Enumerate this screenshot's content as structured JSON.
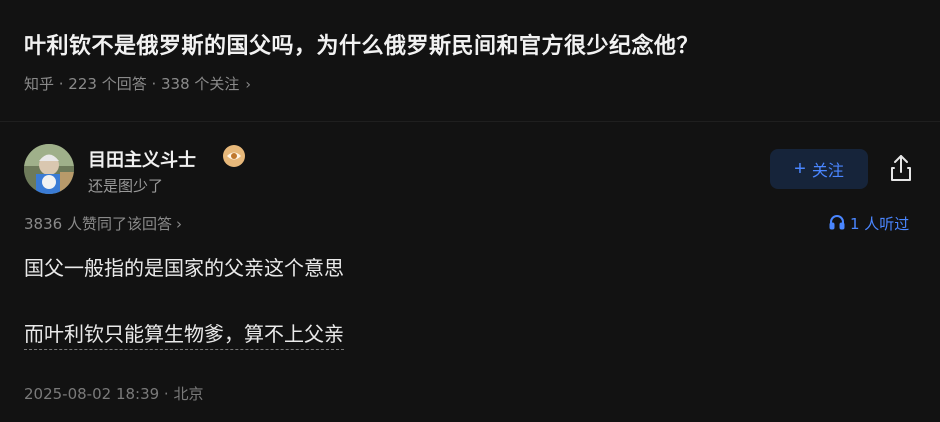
{
  "question": {
    "title": "叶利钦不是俄罗斯的国父吗，为什么俄罗斯民间和官方很少纪念他？",
    "meta": "知乎 · 223 个回答 · 338 个关注"
  },
  "author": {
    "name": "目田主义斗士",
    "bio": "还是图少了",
    "badge_icon": "eye-badge-icon"
  },
  "actions": {
    "follow_label": "关注",
    "share_icon": "share-icon"
  },
  "answer": {
    "likes_text": "3836 人赞同了该回答",
    "listen_text": "1 人听过",
    "paragraphs": [
      "国父一般指的是国家的父亲这个意思",
      "而叶利钦只能算生物爹，算不上父亲"
    ],
    "footer": "2025-08-02 18:39 · 北京"
  },
  "colors": {
    "background": "#121212",
    "accent": "#4a86ff",
    "follow_bg": "#16243a",
    "muted": "#8a8a8a"
  }
}
